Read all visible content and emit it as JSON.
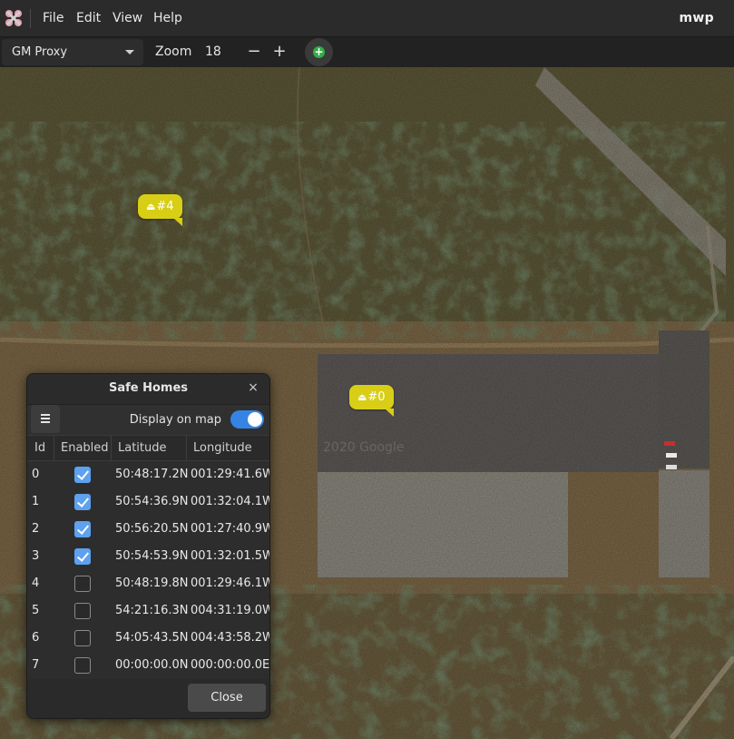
{
  "app": {
    "title": "mwp",
    "menu": [
      "File",
      "Edit",
      "View",
      "Help"
    ]
  },
  "toolbar": {
    "map_source": "GM Proxy",
    "zoom_label": "Zoom",
    "zoom_value": "18",
    "zoom_out": "−",
    "zoom_in": "+",
    "add_icon": "+"
  },
  "map": {
    "markers": [
      {
        "label": "#4"
      },
      {
        "label": "#0"
      }
    ],
    "marker_icon": "home-icon",
    "marker_color": "#d8ce15",
    "watermark": "2020 Google"
  },
  "dialog": {
    "title": "Safe Homes",
    "close_glyph": "×",
    "display_on_map_label": "Display on map",
    "display_on_map": true,
    "columns": [
      "Id",
      "Enabled",
      "Latitude",
      "Longitude"
    ],
    "rows": [
      {
        "id": "0",
        "enabled": true,
        "lat": "50:48:17.2N",
        "lon": "001:29:41.6W"
      },
      {
        "id": "1",
        "enabled": true,
        "lat": "50:54:36.9N",
        "lon": "001:32:04.1W"
      },
      {
        "id": "2",
        "enabled": true,
        "lat": "50:56:20.5N",
        "lon": "001:27:40.9W"
      },
      {
        "id": "3",
        "enabled": true,
        "lat": "50:54:53.9N",
        "lon": "001:32:01.5W"
      },
      {
        "id": "4",
        "enabled": false,
        "lat": "50:48:19.8N",
        "lon": "001:29:46.1W"
      },
      {
        "id": "5",
        "enabled": false,
        "lat": "54:21:16.3N",
        "lon": "004:31:19.0W"
      },
      {
        "id": "6",
        "enabled": false,
        "lat": "54:05:43.5N",
        "lon": "004:43:58.2W"
      },
      {
        "id": "7",
        "enabled": false,
        "lat": "00:00:00.0N",
        "lon": "000:00:00.0E"
      }
    ],
    "close_button": "Close",
    "accent": "#3584e4"
  }
}
